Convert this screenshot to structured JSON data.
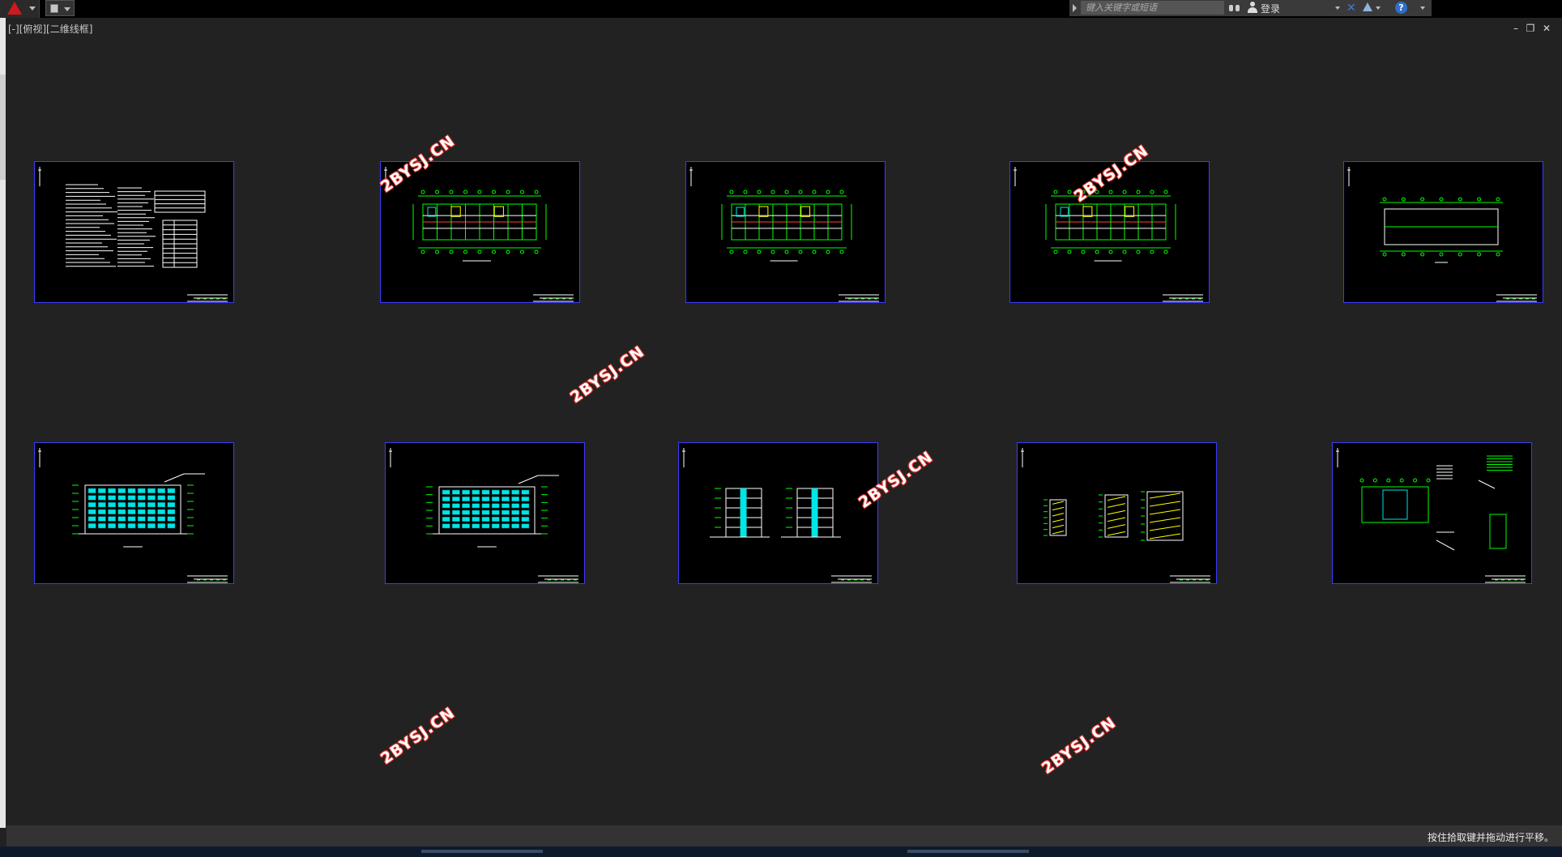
{
  "toolbar": {
    "app_icon": "autocad-logo-icon",
    "quick_access_icon": "save-icon"
  },
  "infocenter": {
    "search_placeholder": "键入关键字或短语",
    "login_label": "登录",
    "help_glyph": "?"
  },
  "viewport": {
    "label": "[-][俯视][二维线框]"
  },
  "sheets": [
    {
      "id": "sheet-design-notes"
    },
    {
      "id": "sheet-plan-1"
    },
    {
      "id": "sheet-plan-2"
    },
    {
      "id": "sheet-plan-3"
    },
    {
      "id": "sheet-roof-plan"
    },
    {
      "id": "sheet-elevation-1"
    },
    {
      "id": "sheet-elevation-2"
    },
    {
      "id": "sheet-sections"
    },
    {
      "id": "sheet-stair-details"
    },
    {
      "id": "sheet-details"
    }
  ],
  "watermark_text": "2BYSJ.CN",
  "status": {
    "message": "按住拾取键并拖动进行平移。"
  },
  "colors": {
    "background": "#222222",
    "sheet_border": "#3b3bff",
    "drawing_green": "#00ff00",
    "drawing_cyan": "#00e5e5",
    "drawing_yellow": "#ffff00",
    "watermark_red": "#e0322b"
  }
}
